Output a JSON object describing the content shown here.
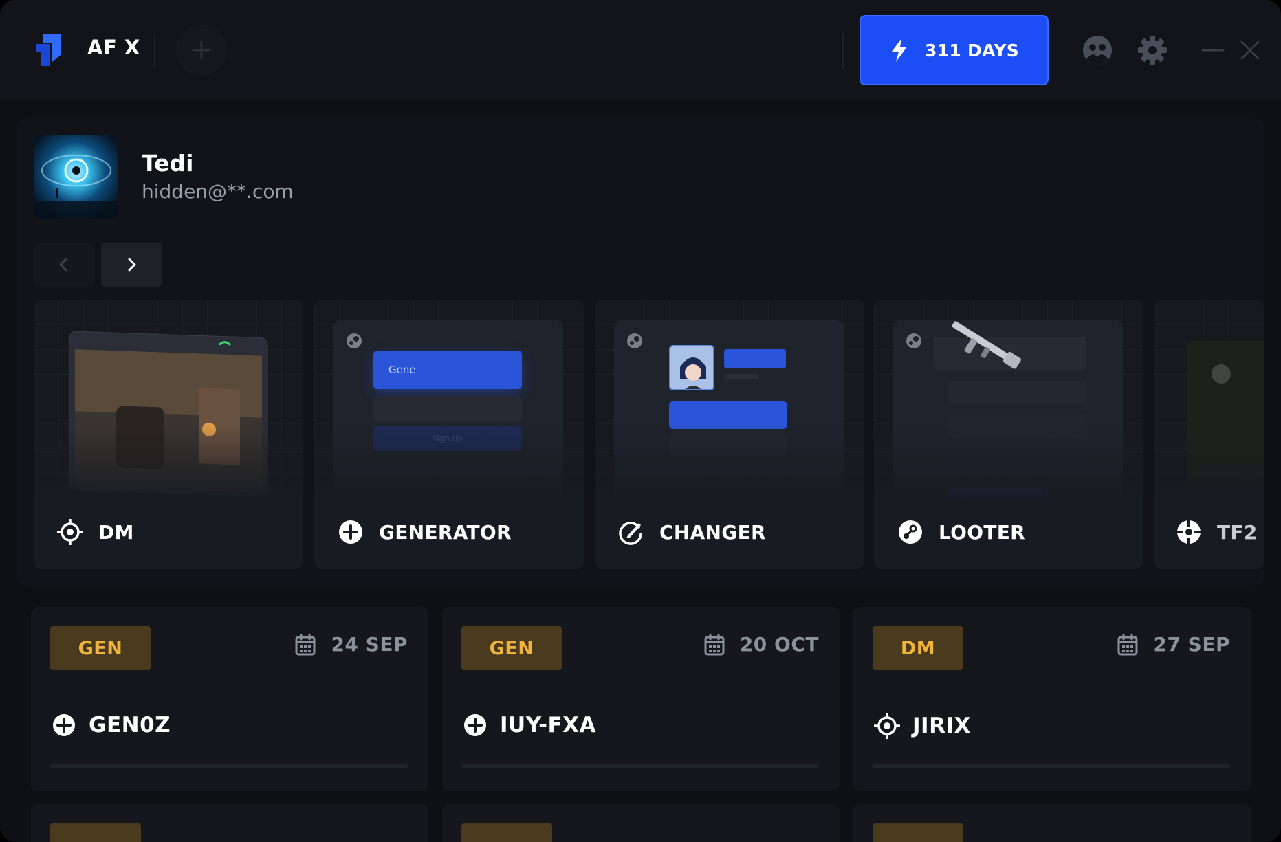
{
  "app": {
    "title": "AF X",
    "subscription_label": "311 DAYS",
    "icons": [
      "logo-icon",
      "add-tab-icon",
      "bolt-icon",
      "users-icon",
      "gear-icon",
      "minimize-icon",
      "close-icon"
    ]
  },
  "user": {
    "name": "Tedi",
    "email": "hidden@**.com"
  },
  "tools": [
    {
      "label": "DM",
      "icon": "crosshair-icon"
    },
    {
      "label": "GENERATOR",
      "icon": "plus-circle-icon"
    },
    {
      "label": "CHANGER",
      "icon": "edit-circle-icon"
    },
    {
      "label": "LOOTER",
      "icon": "steam-icon"
    },
    {
      "label": "TF2",
      "icon": "tf2-icon"
    }
  ],
  "tool_mock_text": {
    "generate_button": "Gene",
    "sign_up": "sign up"
  },
  "sessions": [
    {
      "badge": "GEN",
      "date": "24 SEP",
      "name": "GEN0Z",
      "icon": "plus-circle-icon"
    },
    {
      "badge": "GEN",
      "date": "20 OCT",
      "name": "IUY-FXA",
      "icon": "plus-circle-icon"
    },
    {
      "badge": "DM",
      "date": "27 SEP",
      "name": "JIRIX",
      "icon": "crosshair-icon"
    }
  ],
  "colors": {
    "background": "#0e1014",
    "accent": "#1c4ef5",
    "badge_bg": "#4a3a1e",
    "badge_text": "#f0b43e"
  }
}
